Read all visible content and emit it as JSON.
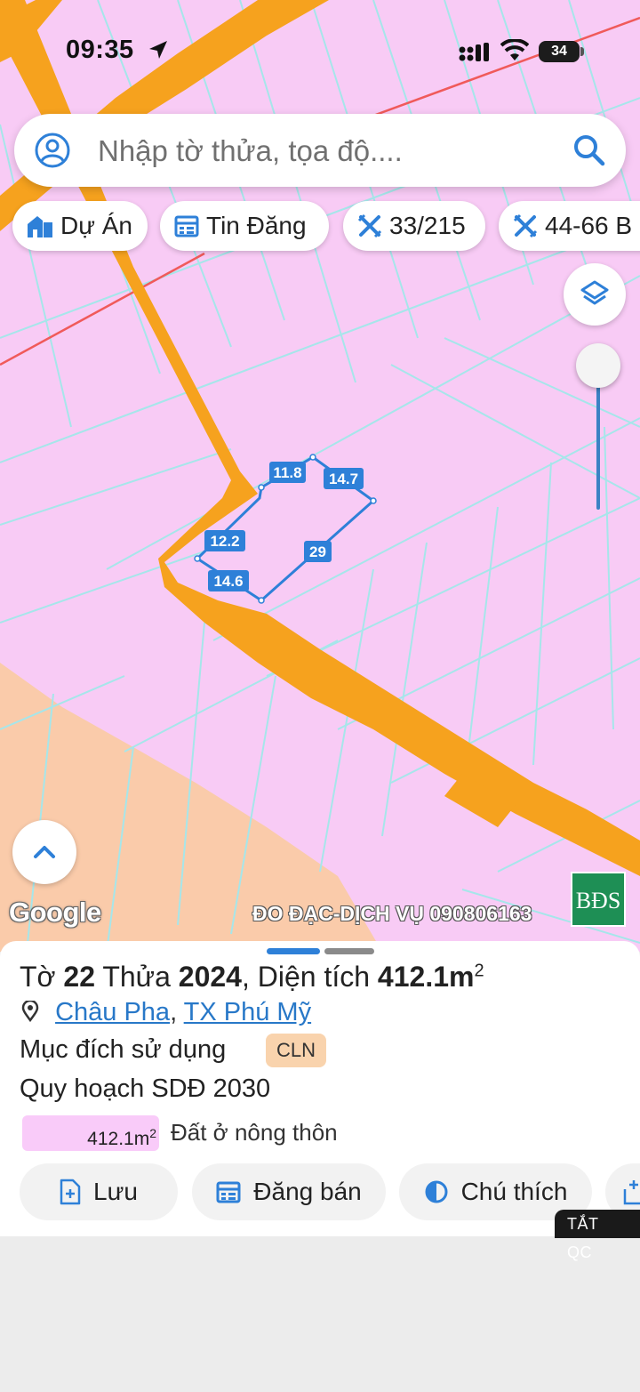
{
  "status_bar": {
    "time": "09:35",
    "battery": "34"
  },
  "search": {
    "placeholder": "Nhập tờ thửa, tọa độ...."
  },
  "chips": [
    {
      "label": "Dự Án",
      "icon": "building-icon"
    },
    {
      "label": "Tin Đăng",
      "icon": "calendar-icon"
    },
    {
      "label": "33/215",
      "icon": "ruler-cross-icon"
    },
    {
      "label": "44-66 B",
      "icon": "ruler-cross-icon"
    }
  ],
  "map": {
    "edge_labels": [
      "11.8",
      "14.7",
      "12.2",
      "29",
      "14.6"
    ],
    "google_label": "Google",
    "watermark": "ĐO ĐẠC-DỊCH VỤ 090806163",
    "logo_text": "BĐS",
    "colors": {
      "land": "#f8cbf5",
      "road": "#f6a21e",
      "orange_zone": "#facbaa",
      "parcel": "#2e80d8",
      "grid": "#a6e6ea"
    }
  },
  "parcel": {
    "sheet_label": "Tờ",
    "sheet": "22",
    "plot_label": "Thửa",
    "plot": "2024",
    "area_label": "Diện tích",
    "area": "412.1m",
    "area_unit_sup": "2",
    "commune": "Châu Pha",
    "town": "TX Phú Mỹ",
    "purpose_label": "Mục đích sử dụng",
    "purpose_code": "CLN",
    "plan_label": "Quy hoạch SDĐ 2030",
    "legend_area": "412.1m",
    "legend_sup": "2",
    "legend_text": "Đất ở nông thôn"
  },
  "actions": [
    {
      "label": "Lưu",
      "icon": "save-doc-icon"
    },
    {
      "label": "Đăng bán",
      "icon": "calendar-icon"
    },
    {
      "label": "Chú thích",
      "icon": "half-circle-icon"
    },
    {
      "label": "",
      "icon": "add-doc-icon"
    }
  ],
  "ads_off": "TẮT QC"
}
